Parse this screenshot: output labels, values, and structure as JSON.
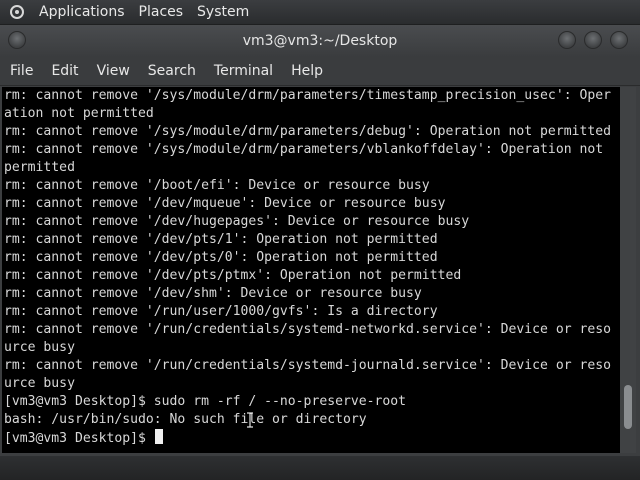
{
  "panel": {
    "menus": [
      "Applications",
      "Places",
      "System"
    ]
  },
  "window": {
    "title": "vm3@vm3:~/Desktop",
    "menus": [
      "File",
      "Edit",
      "View",
      "Search",
      "Terminal",
      "Help"
    ]
  },
  "terminal": {
    "lines": [
      "rm: cannot remove '/sys/module/drm/parameters/timestamp_precision_usec': Oper",
      "ation not permitted",
      "rm: cannot remove '/sys/module/drm/parameters/debug': Operation not permitted",
      "rm: cannot remove '/sys/module/drm/parameters/vblankoffdelay': Operation not",
      "permitted",
      "rm: cannot remove '/boot/efi': Device or resource busy",
      "rm: cannot remove '/dev/mqueue': Device or resource busy",
      "rm: cannot remove '/dev/hugepages': Device or resource busy",
      "rm: cannot remove '/dev/pts/1': Operation not permitted",
      "rm: cannot remove '/dev/pts/0': Operation not permitted",
      "rm: cannot remove '/dev/pts/ptmx': Operation not permitted",
      "rm: cannot remove '/dev/shm': Device or resource busy",
      "rm: cannot remove '/run/user/1000/gvfs': Is a directory",
      "rm: cannot remove '/run/credentials/systemd-networkd.service': Device or reso",
      "urce busy",
      "rm: cannot remove '/run/credentials/systemd-journald.service': Device or reso",
      "urce busy",
      "[vm3@vm3 Desktop]$ sudo rm -rf / --no-preserve-root",
      "bash: /usr/bin/sudo: No such file or directory"
    ],
    "prompt": "[vm3@vm3 Desktop]$ ",
    "scroll_position": 0.93
  },
  "colors": {
    "terminal_bg": "#000000",
    "terminal_fg": "#d8d8d8",
    "chrome": "#3a3c3e"
  },
  "icons": [
    "distro-logo-icon",
    "window-menu-icon",
    "minimize-icon",
    "maximize-icon",
    "close-icon",
    "text-cursor-icon"
  ]
}
